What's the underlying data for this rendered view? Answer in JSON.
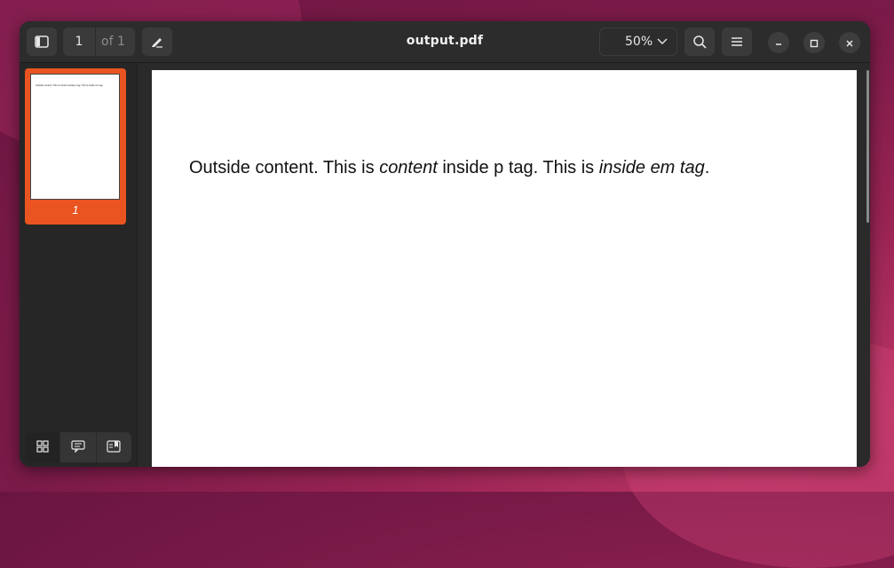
{
  "window": {
    "title": "output.pdf"
  },
  "toolbar": {
    "current_page": "1",
    "page_total": "of 1",
    "zoom": "50%",
    "sidebar_toggle_icon": "sidebar-panel-icon",
    "annotate_icon": "pen-annotate-icon",
    "zoom_icon": "chevron-down-icon",
    "search_icon": "search-icon",
    "menu_icon": "hamburger-menu-icon"
  },
  "window_controls": {
    "minimize_icon": "minimize-icon",
    "maximize_icon": "maximize-icon",
    "close_icon": "close-icon"
  },
  "sidebar": {
    "thumbnail": {
      "page_label": "1",
      "preview_text": "Outside content. This is content inside p tag. This is inside em tag."
    },
    "view_modes": [
      {
        "icon": "grid-thumbnails-icon",
        "active": true
      },
      {
        "icon": "annotations-icon",
        "active": false
      },
      {
        "icon": "bookmarks-icon",
        "active": false
      }
    ]
  },
  "document": {
    "segments": [
      {
        "text": "Outside content. This is ",
        "italic": false
      },
      {
        "text": "content",
        "italic": true
      },
      {
        "text": " inside p tag. This is ",
        "italic": false
      },
      {
        "text": "inside em tag",
        "italic": true
      },
      {
        "text": ".",
        "italic": false
      }
    ]
  },
  "colors": {
    "accent": "#e95420",
    "window_bg": "#2a2a2a",
    "page_bg": "#ffffff"
  }
}
